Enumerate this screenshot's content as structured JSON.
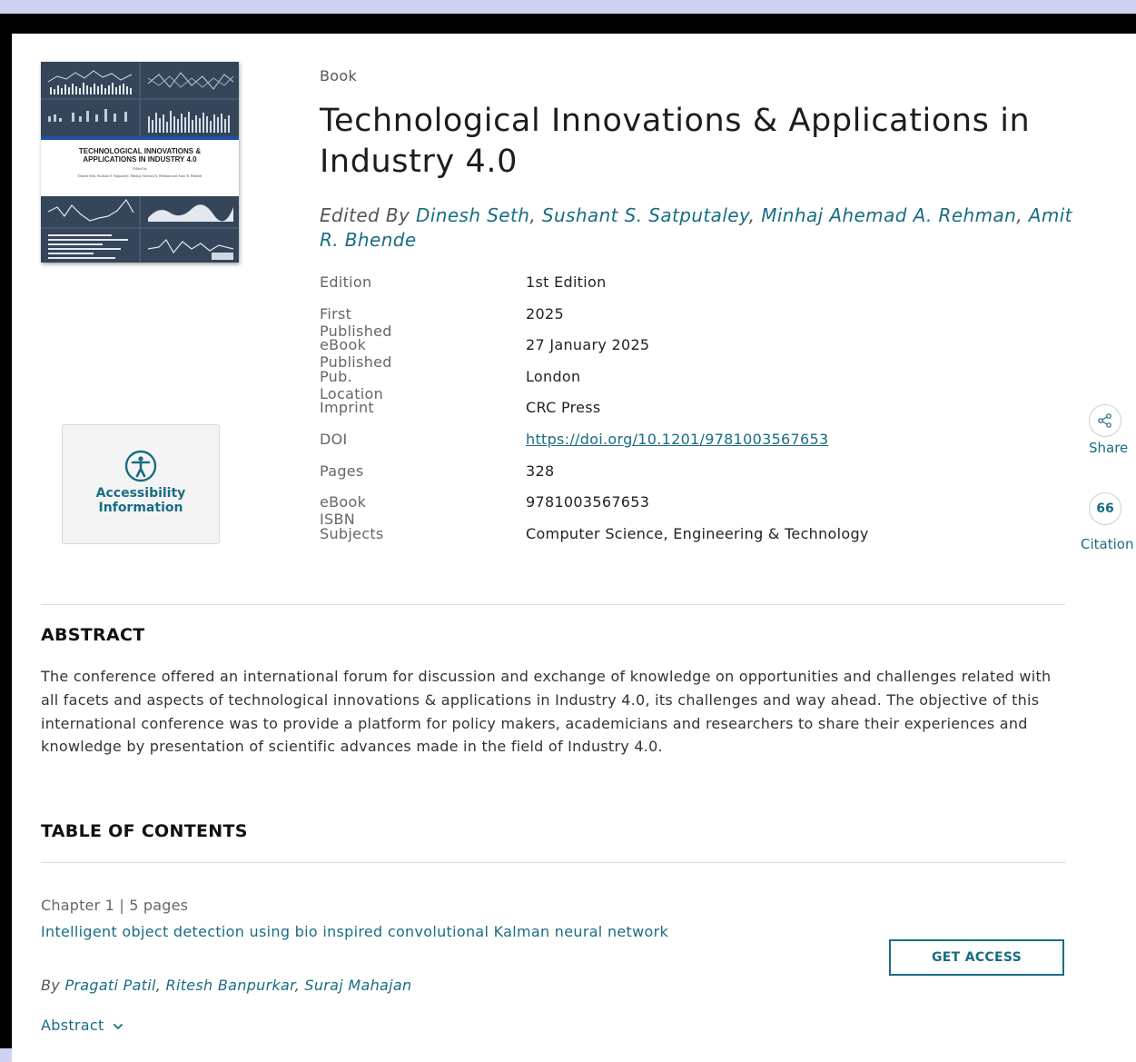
{
  "book": {
    "type": "Book",
    "title": "Technological Innovations & Applications in Industry 4.0",
    "edited_by_prefix": "Edited By",
    "editors": [
      "Dinesh Seth",
      "Sushant S. Satputaley",
      "Minhaj Ahemad A. Rehman",
      "Amit R. Bhende"
    ],
    "cover": {
      "title_text": "TECHNOLOGICAL INNOVATIONS &\nAPPLICATIONS IN INDUSTRY 4.0",
      "edited_text": "Edited by",
      "editors_text": "Dinesh Seth, Sushant S. Satputaley, Minhaj Ahemad A. Rehman and Amit R. Bhende",
      "publisher_logo": "CRC Press"
    }
  },
  "meta": {
    "edition_label": "Edition",
    "edition": "1st Edition",
    "first_published_label": "First Published",
    "first_published": "2025",
    "ebook_published_label": "eBook Published",
    "ebook_published": "27 January 2025",
    "location_label": "Pub. Location",
    "location": "London",
    "imprint_label": "Imprint",
    "imprint": "CRC Press",
    "doi_label": "DOI",
    "doi": "https://doi.org/10.1201/9781003567653",
    "pages_label": "Pages",
    "pages": "328",
    "isbn_label": "eBook ISBN",
    "isbn": "9781003567653",
    "subjects_label": "Subjects",
    "subjects": "Computer Science, Engineering & Technology"
  },
  "accessibility": {
    "label": "Accessibility\nInformation",
    "icon": "accessibility-icon"
  },
  "rail": {
    "share_label": "Share",
    "citation_label": "Citation",
    "citation_icon_text": "66"
  },
  "abstract": {
    "heading": "ABSTRACT",
    "text": "The conference offered an international forum for discussion and exchange of knowledge on opportunities and challenges related with all facets and aspects of technological innovations & applications in Industry 4.0, its challenges and way ahead. The objective of this international conference was to provide a platform for policy makers, academicians and researchers to share their experiences and knowledge by presentation of scientific advances made in the field of Industry 4.0."
  },
  "toc": {
    "heading": "TABLE OF CONTENTS",
    "chapters": [
      {
        "meta": "Chapter 1 | 5 pages",
        "title": "Intelligent object detection using bio inspired convolutional Kalman neural network",
        "by_prefix": "By",
        "authors": [
          "Pragati Patil",
          "Ritesh Banpurkar",
          "Suraj Mahajan"
        ],
        "abstract_toggle": "Abstract",
        "cta": "GET ACCESS"
      }
    ]
  },
  "colors": {
    "link": "#186d82",
    "accent_blue": "#1f4fa6",
    "cover_dark": "#2f3e50"
  }
}
